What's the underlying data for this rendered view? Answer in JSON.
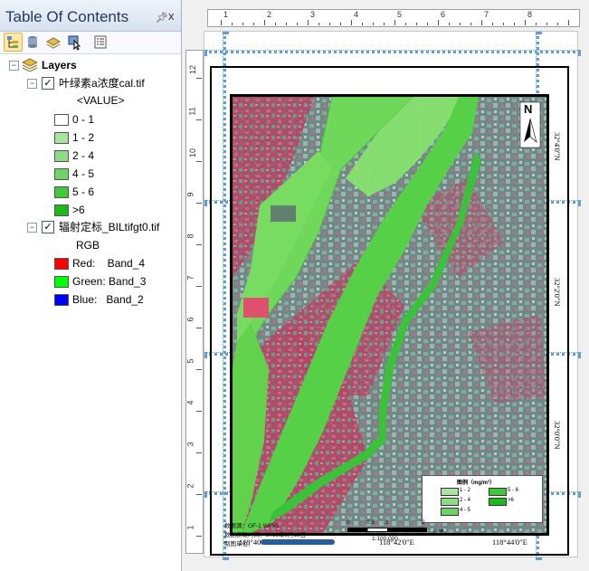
{
  "toc": {
    "title": "Table Of Contents",
    "pin_icon": "pin-icon",
    "close_glyph": "x",
    "tools": [
      "list-by-drawing-order-icon",
      "list-by-source-icon",
      "list-by-visibility-icon",
      "list-by-selection-icon",
      "options-icon"
    ],
    "root": {
      "label": "Layers",
      "expander": "−"
    },
    "layer1": {
      "label": "叶绿素a浓度cal.tif",
      "expander": "−",
      "checked": "✓",
      "field": "<VALUE>",
      "classes": [
        {
          "label": "0 - 1",
          "color": "#ffffff"
        },
        {
          "label": "1 - 2",
          "color": "#a8e6a0"
        },
        {
          "label": "2 - 4",
          "color": "#8fdc86"
        },
        {
          "label": "4 - 5",
          "color": "#6fd468"
        },
        {
          "label": "5 - 6",
          "color": "#3fc93a"
        },
        {
          "label": ">6",
          "color": "#1dbb1a"
        }
      ]
    },
    "layer2": {
      "label": "辐射定标_BILtifgt0.tif",
      "expander": "−",
      "checked": "✓",
      "type": "RGB",
      "bands": [
        {
          "label": "Red:    Band_4",
          "color": "#ff0000"
        },
        {
          "label": "Green: Band_3",
          "color": "#00ff00"
        },
        {
          "label": "Blue:   Band_2",
          "color": "#0000ff"
        }
      ]
    }
  },
  "layout": {
    "ruler_top_labels": [
      "1",
      "2",
      "3",
      "4",
      "5",
      "6",
      "7",
      "8"
    ],
    "ruler_left_labels": [
      "12",
      "11",
      "10",
      "9",
      "8",
      "7",
      "6",
      "5",
      "4",
      "3",
      "2",
      "1"
    ],
    "north_letter": "N",
    "lon_labels": [
      "118°40'0\"E",
      "118°42'0\"E",
      "118°44'0\"E"
    ],
    "lat_labels": [
      "32°4'0\"N",
      "32°2'0\"N",
      "32°0'0\"N"
    ],
    "legend": {
      "title": "图例（mg/m³）",
      "items": [
        "1 - 2",
        "2 - 4",
        "4 - 5",
        "5 - 6",
        ">6"
      ]
    },
    "credits": [
      "数据源：GF-1 WFV1",
      "数据获取时间：2013年8月13日",
      "制图单位："
    ],
    "scale_ticks": [
      "0",
      "0.5",
      "1",
      "2"
    ],
    "scale_unit": "公里",
    "scale_text": "1:100,000"
  },
  "colors": {
    "accent": "#1e395b",
    "river": "#6fd85a",
    "river_dark": "#3cc13a",
    "urban": "#c74a6a"
  }
}
